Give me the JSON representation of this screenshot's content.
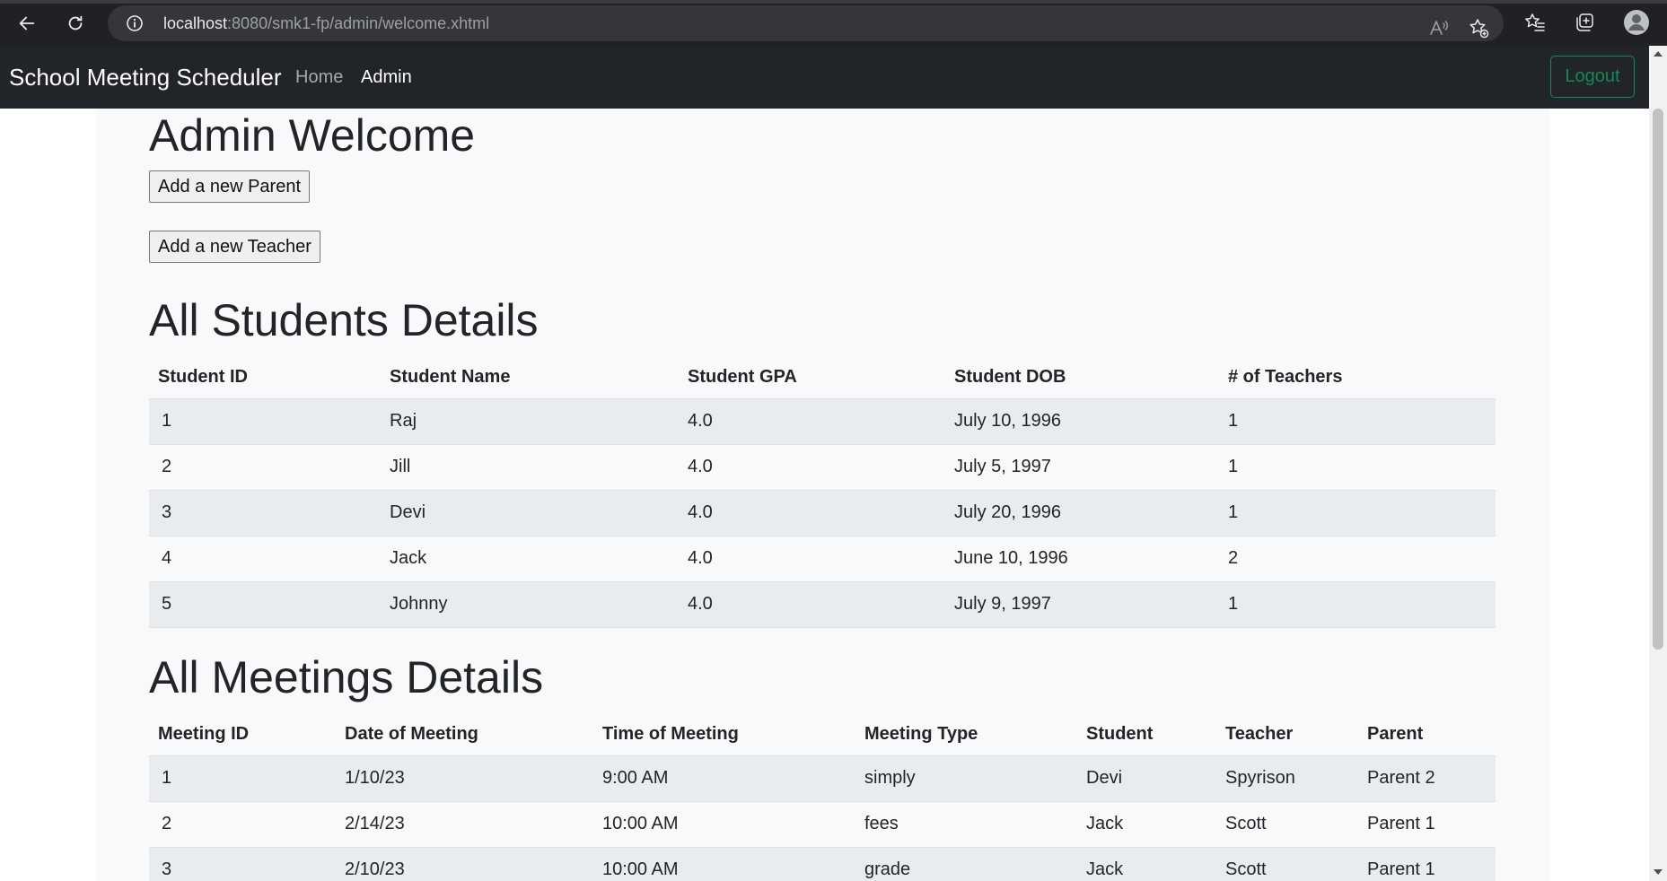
{
  "browser": {
    "url_host": "localhost",
    "url_path": ":8080/smk1-fp/admin/welcome.xhtml"
  },
  "navbar": {
    "brand": "School Meeting Scheduler",
    "links": [
      {
        "label": "Home"
      },
      {
        "label": "Admin"
      }
    ],
    "logout_label": "Logout"
  },
  "page": {
    "title": "Admin Welcome",
    "add_parent_label": "Add a new Parent",
    "add_teacher_label": "Add a new Teacher"
  },
  "students": {
    "title": "All Students Details",
    "columns": [
      "Student ID",
      "Student Name",
      "Student GPA",
      "Student DOB",
      "# of Teachers"
    ],
    "rows": [
      [
        "1",
        "Raj",
        "4.0",
        "July 10, 1996",
        "1"
      ],
      [
        "2",
        "Jill",
        "4.0",
        "July 5, 1997",
        "1"
      ],
      [
        "3",
        "Devi",
        "4.0",
        "July 20, 1996",
        "1"
      ],
      [
        "4",
        "Jack",
        "4.0",
        "June 10, 1996",
        "2"
      ],
      [
        "5",
        "Johnny",
        "4.0",
        "July 9, 1997",
        "1"
      ]
    ]
  },
  "meetings": {
    "title": "All Meetings Details",
    "columns": [
      "Meeting ID",
      "Date of Meeting",
      "Time of Meeting",
      "Meeting Type",
      "Student",
      "Teacher",
      "Parent"
    ],
    "rows": [
      [
        "1",
        "1/10/23",
        "9:00 AM",
        "simply",
        "Devi",
        "Spyrison",
        "Parent 2"
      ],
      [
        "2",
        "2/14/23",
        "10:00 AM",
        "fees",
        "Jack",
        "Scott",
        "Parent 1"
      ],
      [
        "3",
        "2/10/23",
        "10:00 AM",
        "grade",
        "Jack",
        "Scott",
        "Parent 1"
      ]
    ]
  },
  "colors": {
    "navbar_bg": "#212529",
    "logout_accent": "#198754",
    "stripe": "#e9ecef"
  }
}
